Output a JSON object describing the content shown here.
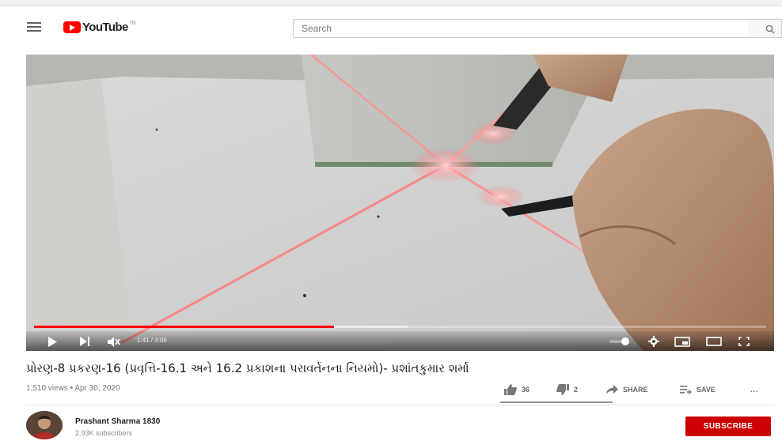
{
  "masthead": {
    "logo_text": "YouTube",
    "country_code": "IN",
    "search_placeholder": "Search"
  },
  "player": {
    "time_display": "1:41 / 4:06",
    "progress_played_fraction": 0.41,
    "progress_loaded_fraction": 0.51
  },
  "video": {
    "title": "પ્રોરણ-8 પ્રકરણ-16 (પ્રવૃત્તિ-16.1 અને 16.2 પ્રકાશના પરાવર્તનના નિયમો)- પ્રશાંતકુમાર શર્મા",
    "meta": "1,510 views • Apr 30, 2020"
  },
  "actions": {
    "likes": "36",
    "dislikes": "2",
    "share_label": "SHARE",
    "save_label": "SAVE",
    "more_label": "..."
  },
  "channel": {
    "name": "Prashant Sharma 1830",
    "subscribers": "2.93K subscribers",
    "subscribe_label": "SUBSCRIBE"
  },
  "colors": {
    "brand_red": "#ff0000",
    "subscribe_red": "#cc0000"
  }
}
